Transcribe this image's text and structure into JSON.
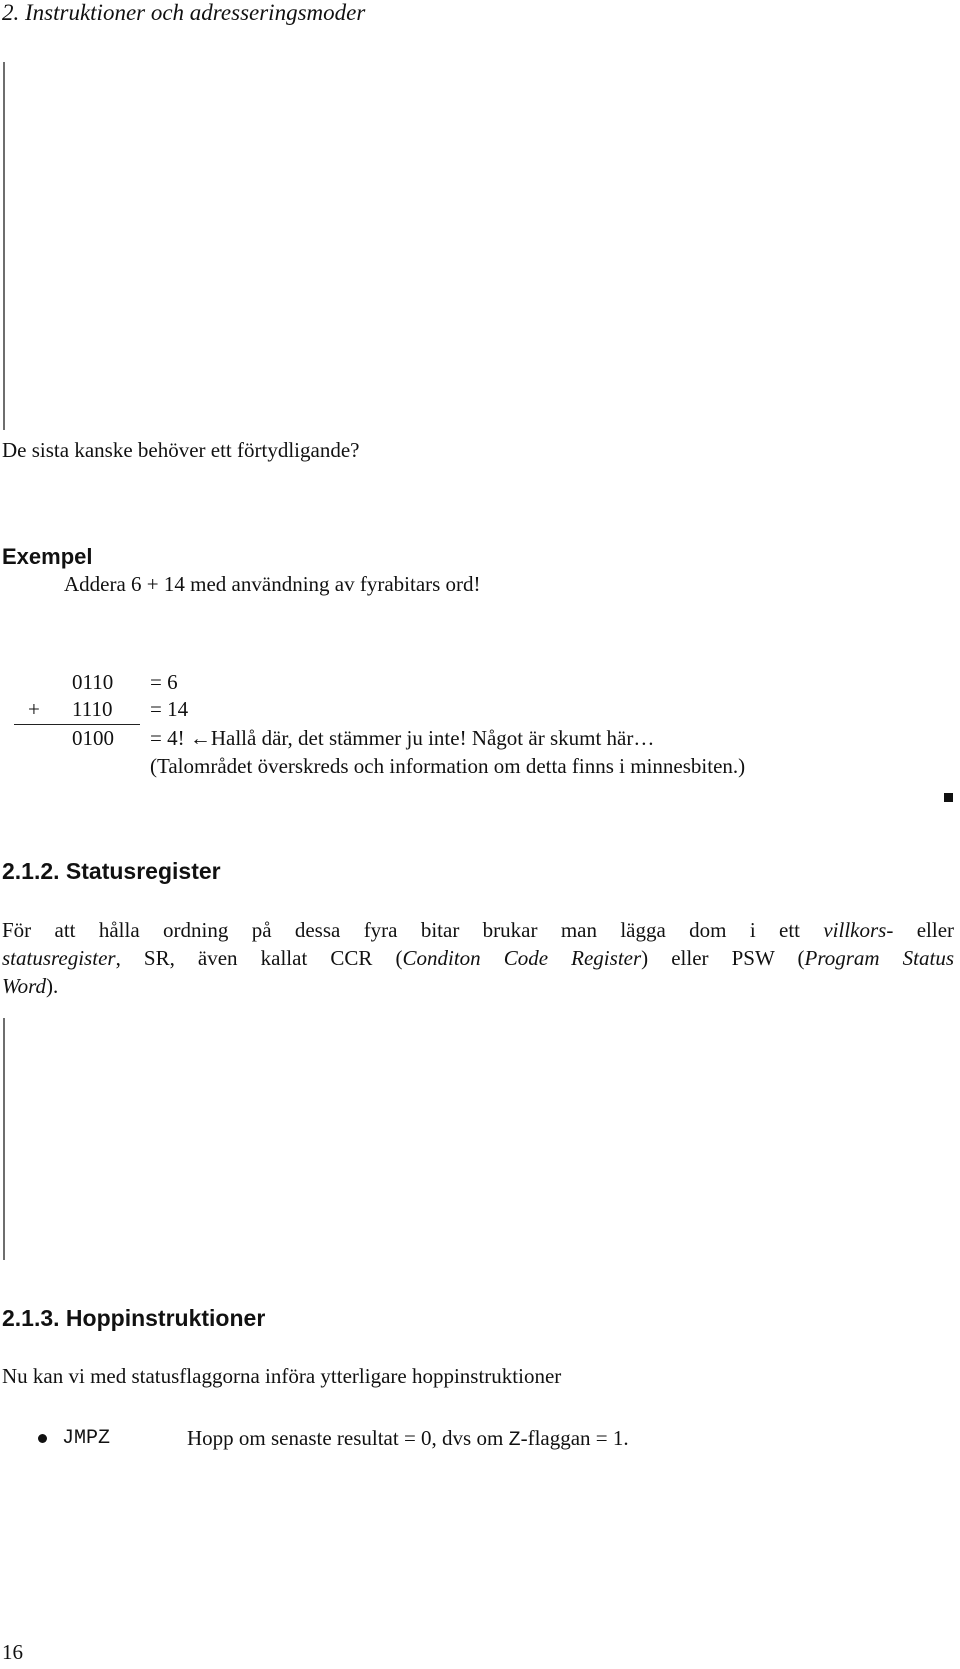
{
  "running_head": "2.  Instruktioner och adresseringsmoder",
  "intro_line": "De sista kanske behöver ett förtydligande?",
  "example": {
    "heading": "Exempel",
    "task": "Addera 6 + 14 med användning av fyrabitars ord!",
    "calculation": {
      "rows": [
        {
          "operator": "",
          "binary": "0110",
          "result": "= 6"
        },
        {
          "operator": "+",
          "binary": "1110",
          "result": "= 14"
        },
        {
          "operator": "",
          "binary": "0100",
          "result": "= 4! ←Hallå där, det stämmer ju inte! Något är skumt här…"
        }
      ],
      "note": "(Talområdet överskreds och information om detta finns i minnesbiten.)"
    }
  },
  "section_212": {
    "heading": "2.1.2.  Statusregister",
    "paragraph": {
      "line1_before": "För att hålla ordning på dessa fyra bitar brukar man lägga dom i ett ",
      "line1_em": "villkors",
      "line1_after": "- eller",
      "line2_em1": "statusregister",
      "line2_mid1": ", SR, även kallat CCR (",
      "line2_em2": "Conditon Code Register",
      "line2_mid2": ") eller PSW (",
      "line2_em3": "Program Status",
      "line3_em": "Word",
      "line3_after": ")."
    }
  },
  "section_213": {
    "heading": "2.1.3.  Hoppinstruktioner",
    "intro": "Nu kan vi med statusflaggorna införa ytterligare hoppinstruktioner",
    "items": [
      {
        "mnemonic": "JMPZ",
        "desc_before": "Hopp om senaste resultat = 0, dvs om ",
        "desc_code": "Z",
        "desc_after": "-flaggan = 1."
      }
    ]
  },
  "page_number": "16"
}
